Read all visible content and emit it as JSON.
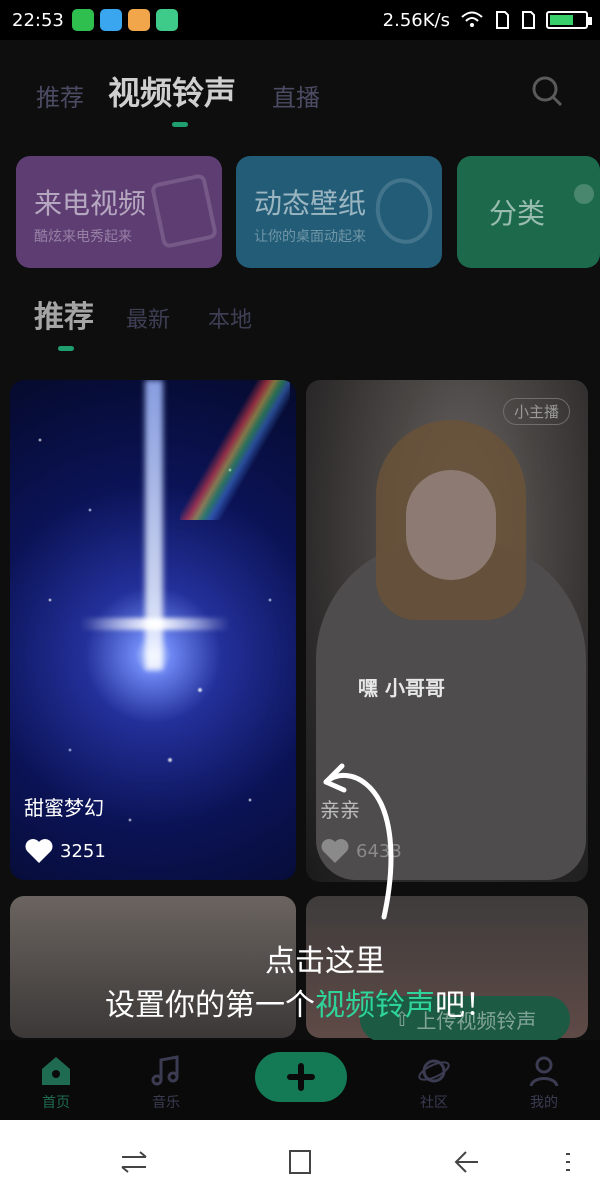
{
  "status_bar": {
    "time": "22:53",
    "speed": "2.56K/s",
    "battery_level": 0.6,
    "app_icon_colors": [
      "#2fbf4f",
      "#3aa6f0",
      "#f2a64b",
      "#3ecb8a"
    ]
  },
  "top_tabs": [
    {
      "label": "推荐",
      "active": false
    },
    {
      "label": "视频铃声",
      "active": true
    },
    {
      "label": "直播",
      "active": false
    }
  ],
  "feature_cards": [
    {
      "title": "来电视频",
      "subtitle": "酷炫来电秀起来"
    },
    {
      "title": "动态壁纸",
      "subtitle": "让你的桌面动起来"
    },
    {
      "title": "分类",
      "subtitle": ""
    }
  ],
  "sub_tabs": [
    {
      "label": "推荐",
      "active": true
    },
    {
      "label": "最新",
      "active": false
    },
    {
      "label": "本地",
      "active": false
    }
  ],
  "videos": [
    {
      "title": "甜蜜梦幻",
      "likes": "3251"
    },
    {
      "title": "亲亲",
      "likes": "6433",
      "badge": "小主播",
      "caption": "嘿 小哥哥"
    }
  ],
  "upload_button": {
    "label": "上传视频铃声"
  },
  "bottom_nav": [
    {
      "label": "首页",
      "icon": "home-icon"
    },
    {
      "label": "音乐",
      "icon": "music-icon"
    },
    {
      "label": "",
      "icon": "plus-icon"
    },
    {
      "label": "社区",
      "icon": "planet-icon"
    },
    {
      "label": "我的",
      "icon": "person-icon"
    }
  ],
  "guide": {
    "line1": "点击这里",
    "line2_prefix": "设置你的第一个",
    "line2_highlight": "视频铃声",
    "line2_suffix": "吧！"
  },
  "colors": {
    "accent": "#1f9e70",
    "highlight": "#2ed49a"
  }
}
